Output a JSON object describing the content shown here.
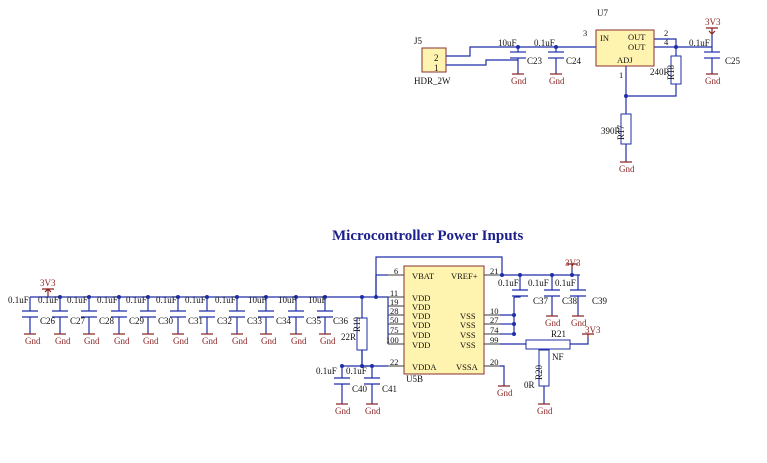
{
  "title": "Microcontroller Power Inputs",
  "net_names": {
    "power": "3V3",
    "ground": "Gnd"
  },
  "connector": {
    "ref": "J5",
    "value": "HDR_2W",
    "pins": [
      "2",
      "1"
    ]
  },
  "regulator": {
    "ref": "U7",
    "pins": [
      {
        "label": "IN",
        "num": "3"
      },
      {
        "label": "OUT",
        "num": "2"
      },
      {
        "label": "OUT",
        "num": "4"
      },
      {
        "label": "ADJ",
        "num": "1"
      }
    ]
  },
  "reg_caps": [
    {
      "ref": "C23",
      "value": "10uF"
    },
    {
      "ref": "C24",
      "value": "0.1uF"
    },
    {
      "ref": "C25",
      "value": "0.1uF"
    }
  ],
  "reg_resistors": [
    {
      "ref": "R18",
      "value": "240R"
    },
    {
      "ref": "R17",
      "value": "390R"
    }
  ],
  "decoupling_caps": [
    {
      "ref": "C26",
      "value": "0.1uF"
    },
    {
      "ref": "C27",
      "value": "0.1uF"
    },
    {
      "ref": "C28",
      "value": "0.1uF"
    },
    {
      "ref": "C29",
      "value": "0.1uF"
    },
    {
      "ref": "C30",
      "value": "0.1uF"
    },
    {
      "ref": "C31",
      "value": "0.1uF"
    },
    {
      "ref": "C32",
      "value": "0.1uF"
    },
    {
      "ref": "C33",
      "value": "0.1uF"
    },
    {
      "ref": "C34",
      "value": "10uF"
    },
    {
      "ref": "C35",
      "value": "10uF"
    },
    {
      "ref": "C36",
      "value": "10uF"
    }
  ],
  "mcu": {
    "ref": "U5B",
    "left_pins": [
      {
        "label": "VBAT",
        "num": "6"
      },
      {
        "label": "VDD",
        "num": "11"
      },
      {
        "label": "VDD",
        "num": "19"
      },
      {
        "label": "VDD",
        "num": "28"
      },
      {
        "label": "VDD",
        "num": "50"
      },
      {
        "label": "VDD",
        "num": "75"
      },
      {
        "label": "VDD",
        "num": "100"
      },
      {
        "label": "VDDA",
        "num": "22"
      }
    ],
    "right_pins": [
      {
        "label": "VREF+",
        "num": "21"
      },
      {
        "label": "VSS",
        "num": "10"
      },
      {
        "label": "VSS",
        "num": "27"
      },
      {
        "label": "VSS",
        "num": "74"
      },
      {
        "label": "VSS",
        "num": "99"
      },
      {
        "label": "VSSA",
        "num": "20"
      }
    ]
  },
  "r19": {
    "ref": "R19",
    "value": "22R"
  },
  "vdda_caps": [
    {
      "ref": "C40",
      "value": "0.1uF"
    },
    {
      "ref": "C41",
      "value": "0.1uF"
    }
  ],
  "vref_caps": [
    {
      "ref": "C37",
      "value": "0.1uF"
    },
    {
      "ref": "C38",
      "value": "0.1uF"
    },
    {
      "ref": "C39",
      "value": "0.1uF"
    }
  ],
  "r21": {
    "ref": "R21",
    "value": "NF"
  },
  "r20": {
    "ref": "R20",
    "value": "0R"
  }
}
